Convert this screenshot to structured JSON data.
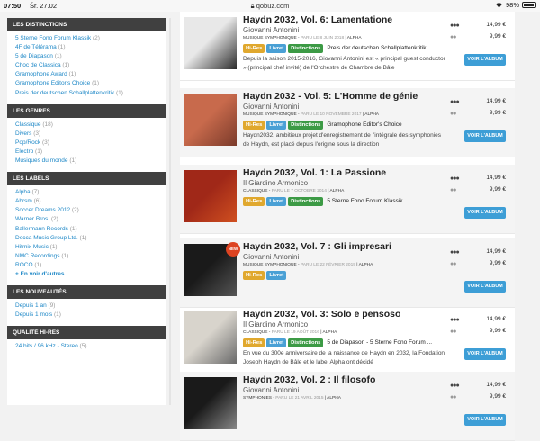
{
  "status_bar": {
    "time": "07:50",
    "day": "Śr. 27.02",
    "url": "qobuz.com",
    "battery": "98%"
  },
  "sidebar": {
    "sections": [
      {
        "title": "LES DISTINCTIONS",
        "items": [
          {
            "label": "5 Sterne Fono Forum Klassik",
            "count": "(2)"
          },
          {
            "label": "4F de Télérama",
            "count": "(1)"
          },
          {
            "label": "5 de Diapason",
            "count": "(1)"
          },
          {
            "label": "Choc de Classica",
            "count": "(1)"
          },
          {
            "label": "Gramophone Award",
            "count": "(1)"
          },
          {
            "label": "Gramophone Editor's Choice",
            "count": "(1)"
          },
          {
            "label": "Preis der deutschen Schallplattenkritik",
            "count": "(1)"
          }
        ]
      },
      {
        "title": "LES GENRES",
        "items": [
          {
            "label": "Classique",
            "count": "(18)"
          },
          {
            "label": "Divers",
            "count": "(3)"
          },
          {
            "label": "Pop/Rock",
            "count": "(3)"
          },
          {
            "label": "Electro",
            "count": "(1)"
          },
          {
            "label": "Musiques du monde",
            "count": "(1)"
          }
        ]
      },
      {
        "title": "LES LABELS",
        "items": [
          {
            "label": "Alpha",
            "count": "(7)"
          },
          {
            "label": "Abrsm",
            "count": "(6)"
          },
          {
            "label": "Soccer Dreams 2012",
            "count": "(2)"
          },
          {
            "label": "Warner Bros.",
            "count": "(2)"
          },
          {
            "label": "Ballermann Records",
            "count": "(1)"
          },
          {
            "label": "Decca Music Group Ltd.",
            "count": "(1)"
          },
          {
            "label": "Hitmix Music",
            "count": "(1)"
          },
          {
            "label": "NMC Recordings",
            "count": "(1)"
          },
          {
            "label": "ROCO",
            "count": "(1)"
          },
          {
            "label": "+ En voir d'autres...",
            "count": ""
          }
        ]
      },
      {
        "title": "LES NOUVEAUTÉS",
        "items": [
          {
            "label": "Depuis 1 an",
            "count": "(9)"
          },
          {
            "label": "Depuis 1 mois",
            "count": "(1)"
          }
        ]
      },
      {
        "title": "QUALITÉ HI-RES",
        "items": [
          {
            "label": "24 bits / 96 kHz - Stereo",
            "count": "(5)"
          }
        ]
      }
    ]
  },
  "albums": [
    {
      "title": "Haydn 2032, Vol. 6: Lamentatione",
      "artist": "Giovanni Antonini",
      "genre": "MUSIQUE SYMPHONIQUE",
      "date": "PARU LE 8 JUIN 2018",
      "label": "ALPHA",
      "badges": [
        "Hi-Res",
        "Livret",
        "Distinctions"
      ],
      "award": "Preis der deutschen Schallplattenkritik",
      "description": "Depuis la saison 2015-2016, Giovanni Antonini est « principal guest conductor » (principal chef invité) de l'Orchestre de Chambre de Bâle",
      "price1": "14,99 €",
      "price2": "9,99 €",
      "button": "VOIR L'ALBUM",
      "new": false
    },
    {
      "title": "Haydn 2032 - Vol. 5: L'Homme de génie",
      "artist": "Giovanni Antonini",
      "genre": "MUSIQUE SYMPHONIQUE",
      "date": "PARU LE 10 NOVEMBRE 2017",
      "label": "ALPHA",
      "badges": [
        "Hi-Res",
        "Livret",
        "Distinctions"
      ],
      "award": "Gramophone Editor's Choice",
      "description": "Haydn2032, ambitieux projet d'enregistrement de l'intégrale des symphonies de Haydn, est placé depuis l'origine sous la direction",
      "price1": "14,99 €",
      "price2": "9,99 €",
      "button": "VOIR L'ALBUM",
      "new": false
    },
    {
      "title": "Haydn 2032, Vol. 1: La Passione",
      "artist": "Il Giardino Armonico",
      "genre": "CLASSIQUE",
      "date": "PARU LE 7 OCTOBRE 2014",
      "label": "ALPHA",
      "badges": [
        "Hi-Res",
        "Livret",
        "Distinctions"
      ],
      "award": "5 Sterne Fono Forum Klassik",
      "description": "",
      "price1": "14,99 €",
      "price2": "9,99 €",
      "button": "VOIR L'ALBUM",
      "new": false
    },
    {
      "title": "Haydn 2032, Vol. 7 : Gli impresari",
      "artist": "Giovanni Antonini",
      "genre": "MUSIQUE SYMPHONIQUE",
      "date": "PARU LE 22 FÉVRIER 2019",
      "label": "ALPHA",
      "badges": [
        "Hi-Res",
        "Livret"
      ],
      "award": "",
      "description": "",
      "price1": "14,99 €",
      "price2": "9,99 €",
      "button": "VOIR L'ALBUM",
      "new": true,
      "new_label": "NEW"
    },
    {
      "title": "Haydn 2032, Vol. 3: Solo e pensoso",
      "artist": "Il Giardino Armonico",
      "genre": "CLASSIQUE",
      "date": "PARU LE 19 AOÛT 2016",
      "label": "ALPHA",
      "badges": [
        "Hi-Res",
        "Livret",
        "Distinctions"
      ],
      "award": "5 de Diapason - 5 Sterne Fono Forum ...",
      "description": "En vue du 300e anniversaire de la naissance de Haydn en 2032, la Fondation Joseph Haydn de Bâle et le label Alpha ont décidé",
      "price1": "14,99 €",
      "price2": "9,99 €",
      "button": "VOIR L'ALBUM",
      "new": false
    },
    {
      "title": "Haydn 2032, Vol. 2 : Il filosofo",
      "artist": "Giovanni Antonini",
      "genre": "SYMPHONIES",
      "date": "PARU LE 21 AVRIL 2015",
      "label": "ALPHA",
      "badges": [],
      "award": "",
      "description": "",
      "price1": "14,99 €",
      "price2": "9,99 €",
      "button": "VOIR L'ALBUM",
      "new": false
    }
  ],
  "colors": {
    "accent": "#3d9ed6",
    "hires": "#e0a82e",
    "livret": "#4aa0d5",
    "distinctions": "#3c9a45",
    "sidebar_header": "#404040",
    "link": "#1e88c7"
  }
}
